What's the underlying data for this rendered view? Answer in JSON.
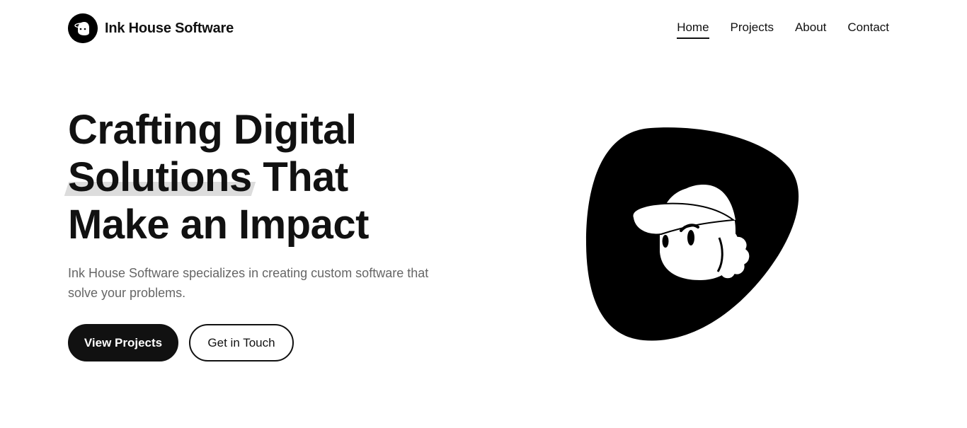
{
  "header": {
    "brand_name": "Ink House Software",
    "logo_icon": "avatar-logo-icon",
    "nav": [
      {
        "label": "Home",
        "active": true
      },
      {
        "label": "Projects",
        "active": false
      },
      {
        "label": "About",
        "active": false
      },
      {
        "label": "Contact",
        "active": false
      }
    ]
  },
  "hero": {
    "title_line1": "Crafting Digital",
    "title_line2_highlight": "Solutions",
    "title_line2_rest": " That",
    "title_line3": "Make an Impact",
    "subtitle": "Ink House Software specializes in creating custom software that solve your problems.",
    "primary_button": "View Projects",
    "secondary_button": "Get in Touch",
    "illustration_icon": "character-with-cap-illustration"
  },
  "colors": {
    "text": "#111111",
    "muted": "#666666",
    "background": "#ffffff",
    "highlight": "#dcdcdc"
  }
}
